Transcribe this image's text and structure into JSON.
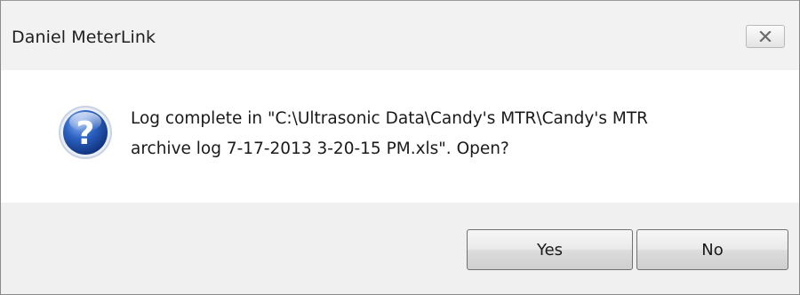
{
  "window": {
    "title": "Daniel MeterLink",
    "close_icon": "close-icon"
  },
  "dialog": {
    "icon": "question-icon",
    "icon_glyph": "?",
    "message": "Log complete in \"C:\\Ultrasonic Data\\Candy's MTR\\Candy's MTR\narchive log 7-17-2013 3-20-15 PM.xls\".  Open?"
  },
  "buttons": {
    "yes_label": "Yes",
    "no_label": "No"
  },
  "colors": {
    "titlebar_bg": "#f2f2f2",
    "footer_bg": "#f0f0f0",
    "icon_blue": "#1c4fa8"
  }
}
